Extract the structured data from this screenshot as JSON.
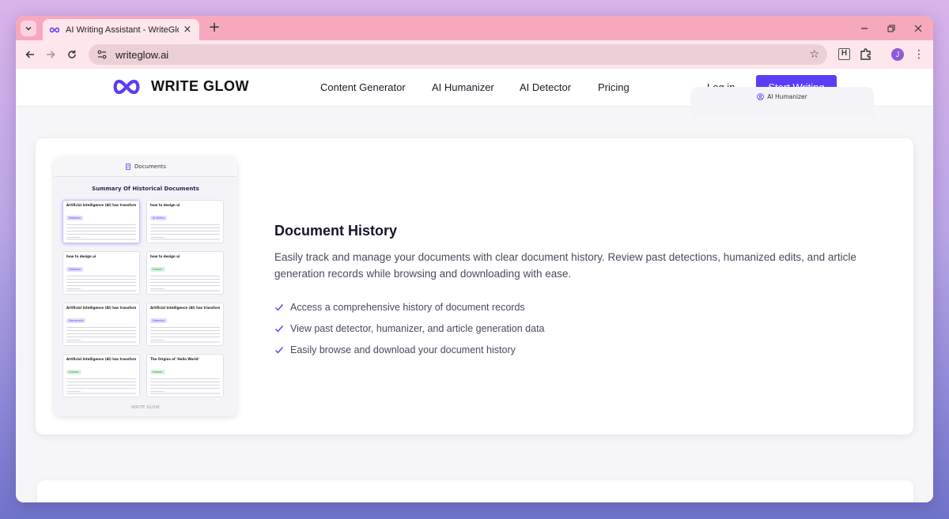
{
  "browser": {
    "tab_title": "AI Writing Assistant - WriteGlo",
    "tab_close": "×",
    "new_tab": "+",
    "url": "writeglow.ai",
    "extension_h": "H",
    "profile_initial": "J"
  },
  "header": {
    "brand": "WRITE GLOW",
    "nav": [
      "Content Generator",
      "AI Humanizer",
      "AI Detector",
      "Pricing"
    ],
    "login": "Log in",
    "cta": "Start Writing"
  },
  "feature": {
    "preview_header": "Documents",
    "preview_title": "Summary Of Historical Documents",
    "preview_brand": "WRITE GLOW",
    "mini_cards": [
      {
        "title": "Artificial Intelligence (AI) has transformed from",
        "tag": "Detector",
        "tag_color": "purple"
      },
      {
        "title": "how to design ui",
        "tag": "AI Writer",
        "tag_color": "purple"
      },
      {
        "title": "how to design ui",
        "tag": "Detector",
        "tag_color": "purple"
      },
      {
        "title": "how to design ui",
        "tag": "Human",
        "tag_color": "green"
      },
      {
        "title": "Artificial Intelligence (AI) has transformed from",
        "tag": "Document",
        "tag_color": "purple"
      },
      {
        "title": "Artificial Intelligence (AI) has transformed from",
        "tag": "Detector",
        "tag_color": "purple"
      },
      {
        "title": "Artificial Intelligence (AI) has transformed from",
        "tag": "Human",
        "tag_color": "green"
      },
      {
        "title": "The Origins of 'Hello World'",
        "tag": "Human",
        "tag_color": "green"
      }
    ],
    "title": "Document History",
    "description": "Easily track and manage your documents with clear document history. Review past detections, humanized edits, and article generation records while browsing and downloading with ease.",
    "bullets": [
      "Access a comprehensive history of document records",
      "View past detector, humanizer, and article generation data",
      "Easily browse and download your document history"
    ]
  },
  "next_section": {
    "preview_label": "AI Humanizer"
  },
  "colors": {
    "accent": "#5b3df5",
    "tab_strip": "#f6a9bd",
    "toolbar": "#fde6ec"
  }
}
